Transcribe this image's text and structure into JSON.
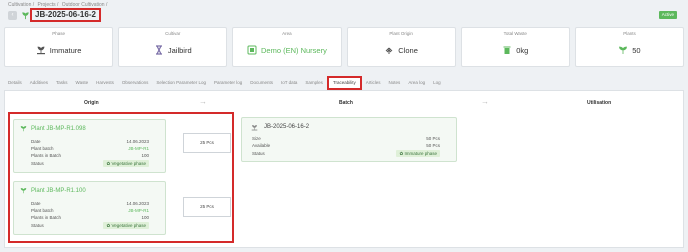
{
  "breadcrumb": [
    "Cultivation /",
    "Projects /",
    "Outdoor Cultivation /"
  ],
  "back_label": "‹",
  "title": "JB-2025-06-16-2",
  "status_badge": "Active",
  "cards": [
    {
      "label": "Phase",
      "value": "Immature",
      "icon": "sprout-icon",
      "green": false
    },
    {
      "label": "Cultivar",
      "value": "Jailbird",
      "icon": "hourglass-icon",
      "green": false
    },
    {
      "label": "Area",
      "value": "Demo (EN) Nursery",
      "icon": "area-icon",
      "green": true
    },
    {
      "label": "Plant Origin",
      "value": "Clone",
      "icon": "clone-icon",
      "green": false
    },
    {
      "label": "Total Waste",
      "value": "0kg",
      "icon": "trash-icon",
      "green": false
    },
    {
      "label": "Plants",
      "value": "50",
      "icon": "seedling-icon",
      "green": false
    }
  ],
  "tabs": [
    "Details",
    "Additives",
    "Tasks",
    "Waste",
    "Harvests",
    "Observations",
    "Selection Parameter Log",
    "Parameter log",
    "Documents",
    "IoT data",
    "Samples",
    "Traceability",
    "Articles",
    "Notes",
    "Area log",
    "Log"
  ],
  "active_tab_index": 11,
  "columns": {
    "origin": "Origin",
    "batch": "Batch",
    "utilisation": "Utilisation"
  },
  "origin": [
    {
      "title": "Plant JB-MP-R1.098",
      "date_label": "Date",
      "date": "14.06.2023",
      "batch_label": "Plant batch",
      "batch": "JB-MP-R1",
      "plants_label": "Plants in Batch",
      "plants": "100",
      "status_label": "Status",
      "status": "Vegetative phase",
      "qty": "25 Pcs"
    },
    {
      "title": "Plant JB-MP-R1.100",
      "date_label": "Date",
      "date": "14.06.2023",
      "batch_label": "Plant batch",
      "batch": "JB-MP-R1",
      "plants_label": "Plants in Batch",
      "plants": "100",
      "status_label": "Status",
      "status": "Vegetative phase",
      "qty": "25 Pcs"
    }
  ],
  "batch": {
    "title": "JB-2025-06-16-2",
    "size_label": "Size",
    "size": "50 Pcs",
    "available_label": "Available",
    "available": "50 Pcs",
    "status_label": "Status",
    "status": "Immature phase"
  },
  "colors": {
    "accent_green": "#5cb85c",
    "highlight_red": "#d42a2a"
  }
}
